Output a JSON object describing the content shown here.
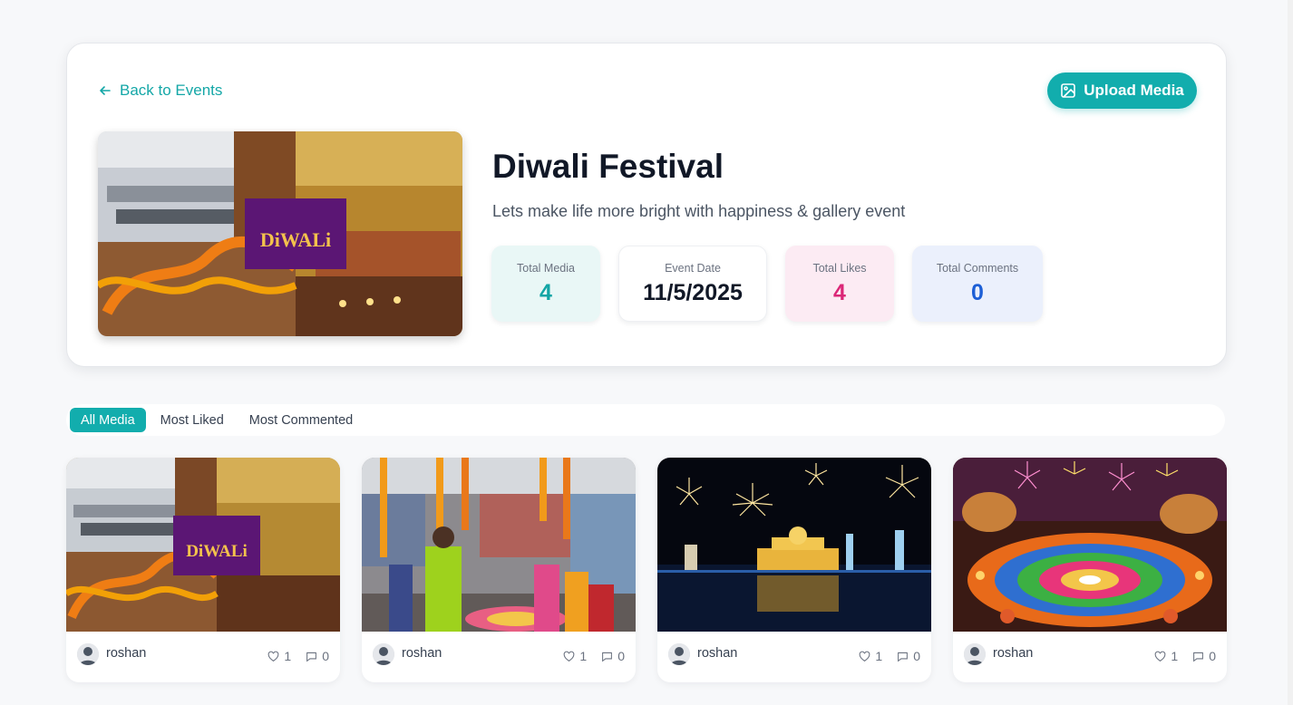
{
  "header": {
    "back_label": "Back to Events",
    "upload_label": "Upload Media",
    "title": "Diwali Festival",
    "subtitle": "Lets make life more bright with happiness & gallery event",
    "cover_banner_text": "Diwali"
  },
  "stats": [
    {
      "label": "Total Media",
      "value": "4",
      "color": "#12a5a5"
    },
    {
      "label": "Event Date",
      "value": "11/5/2025",
      "color": "#111827"
    },
    {
      "label": "Total Likes",
      "value": "4",
      "color": "#db2777"
    },
    {
      "label": "Total Comments",
      "value": "0",
      "color": "#1d5fd6"
    }
  ],
  "tabs": [
    {
      "label": "All Media",
      "active": true
    },
    {
      "label": "Most Liked",
      "active": false
    },
    {
      "label": "Most Commented",
      "active": false
    }
  ],
  "media": [
    {
      "user": "roshan",
      "likes": "1",
      "comments": "0",
      "image": "office-diwali-decor"
    },
    {
      "user": "roshan",
      "likes": "1",
      "comments": "0",
      "image": "team-rangoli-celebration"
    },
    {
      "user": "roshan",
      "likes": "1",
      "comments": "0",
      "image": "golden-temple-fireworks"
    },
    {
      "user": "roshan",
      "likes": "1",
      "comments": "0",
      "image": "rangoli-diyas-fireworks"
    }
  ],
  "colors": {
    "accent": "#12adad",
    "likes": "#db2777",
    "comments": "#1d5fd6"
  },
  "icons": [
    "arrow-left-icon",
    "image-icon",
    "heart-icon",
    "comment-icon",
    "user-avatar-icon"
  ]
}
